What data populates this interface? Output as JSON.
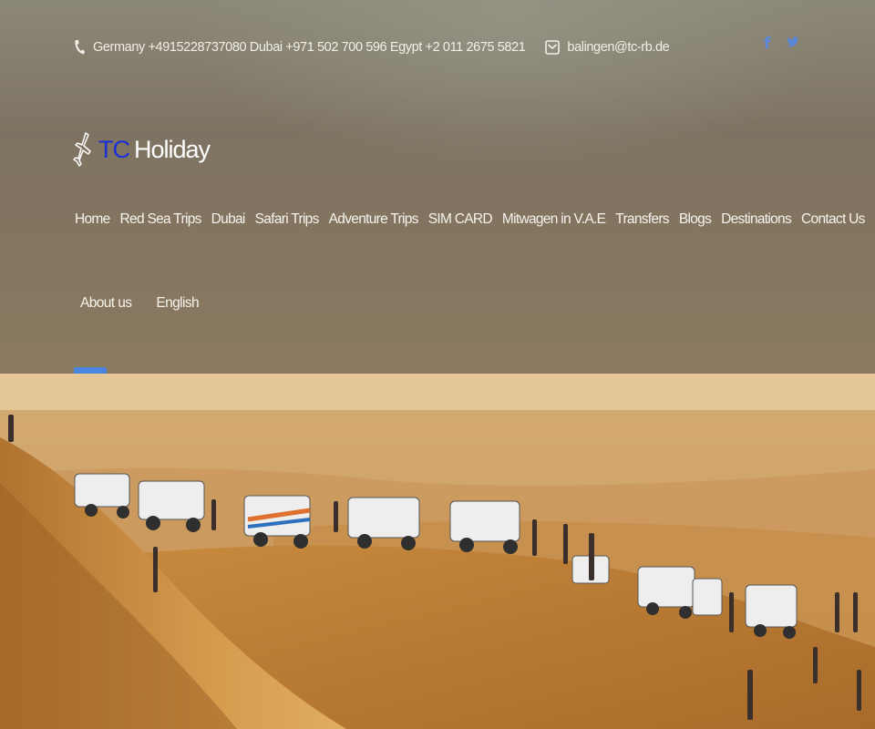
{
  "topbar": {
    "contact_phones": "Germany +4915228737080 Dubai +971 502 700 596 Egypt +2 011 2675 5821",
    "email": "balingen@tc-rb.de",
    "phone_icon": "phone-icon",
    "mail_icon": "mail-icon"
  },
  "socials": [
    {
      "icon": "facebook-icon",
      "glyph": "f"
    },
    {
      "icon": "twitter-icon",
      "glyph": "🐦"
    }
  ],
  "brand": {
    "prefix": "TC",
    "name": "Holiday",
    "icon": "airplane-icon",
    "prefix_color": "#1a2fd6"
  },
  "nav": {
    "items": [
      {
        "label": "Home"
      },
      {
        "label": "Red Sea Trips"
      },
      {
        "label": "Dubai"
      },
      {
        "label": "Safari Trips"
      },
      {
        "label": "Adventure Trips"
      },
      {
        "label": "SIM CARD"
      },
      {
        "label": "Mitwagen in V.A.E"
      },
      {
        "label": "Transfers"
      },
      {
        "label": "Blogs"
      },
      {
        "label": "Destinations"
      },
      {
        "label": "Contact Us"
      },
      {
        "label": "About us"
      },
      {
        "label": "English"
      }
    ],
    "active_index": 0,
    "accent_color": "#4a86df"
  },
  "hero": {
    "alt": "desert-safari-photo"
  }
}
